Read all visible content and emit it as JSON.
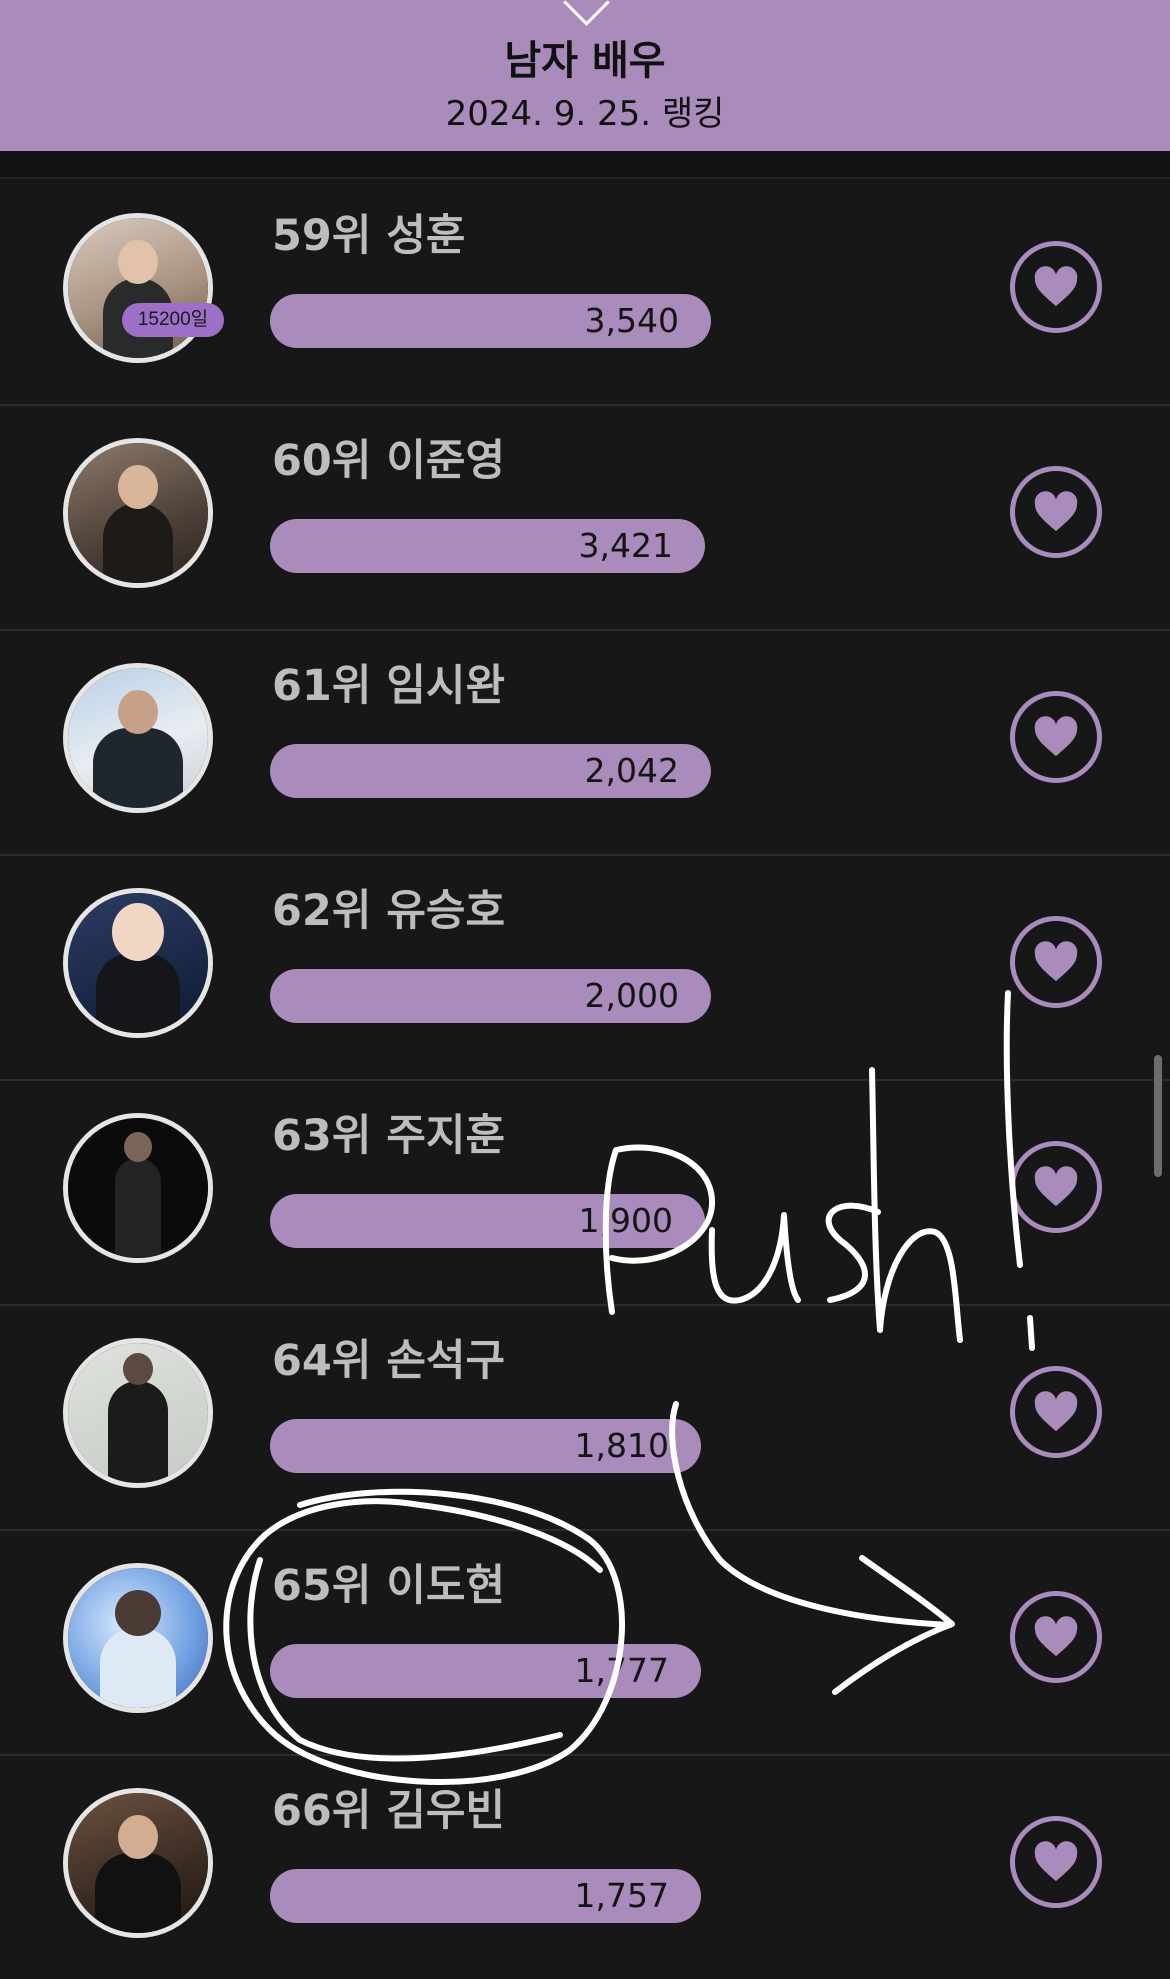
{
  "header": {
    "title": "남자 배우",
    "date": "2024. 9. 25. 랭킹"
  },
  "accent_color": "#a98cbc",
  "badge_color": "#9e6fc7",
  "icons": {
    "vote": "heart-icon",
    "header_toggle": "chevron-down-icon"
  },
  "rows": [
    {
      "rank_name": "59위 성훈",
      "votes": "3,540",
      "badge": "15200일",
      "bar_fill": 1.0
    },
    {
      "rank_name": "60위 이준영",
      "votes": "3,421",
      "bar_fill": 0.986
    },
    {
      "rank_name": "61위 임시완",
      "votes": "2,042",
      "bar_fill": 1.0
    },
    {
      "rank_name": "62위 유승호",
      "votes": "2,000",
      "bar_fill": 1.0
    },
    {
      "rank_name": "63위 주지훈",
      "votes": "1,900",
      "bar_fill": 0.986
    },
    {
      "rank_name": "64위 손석구",
      "votes": "1,810",
      "bar_fill": 0.976
    },
    {
      "rank_name": "65위 이도현",
      "votes": "1,777",
      "bar_fill": 0.976
    },
    {
      "rank_name": "66위 김우빈",
      "votes": "1,757",
      "bar_fill": 0.976
    }
  ],
  "annotation": {
    "handwriting": "Push!"
  }
}
